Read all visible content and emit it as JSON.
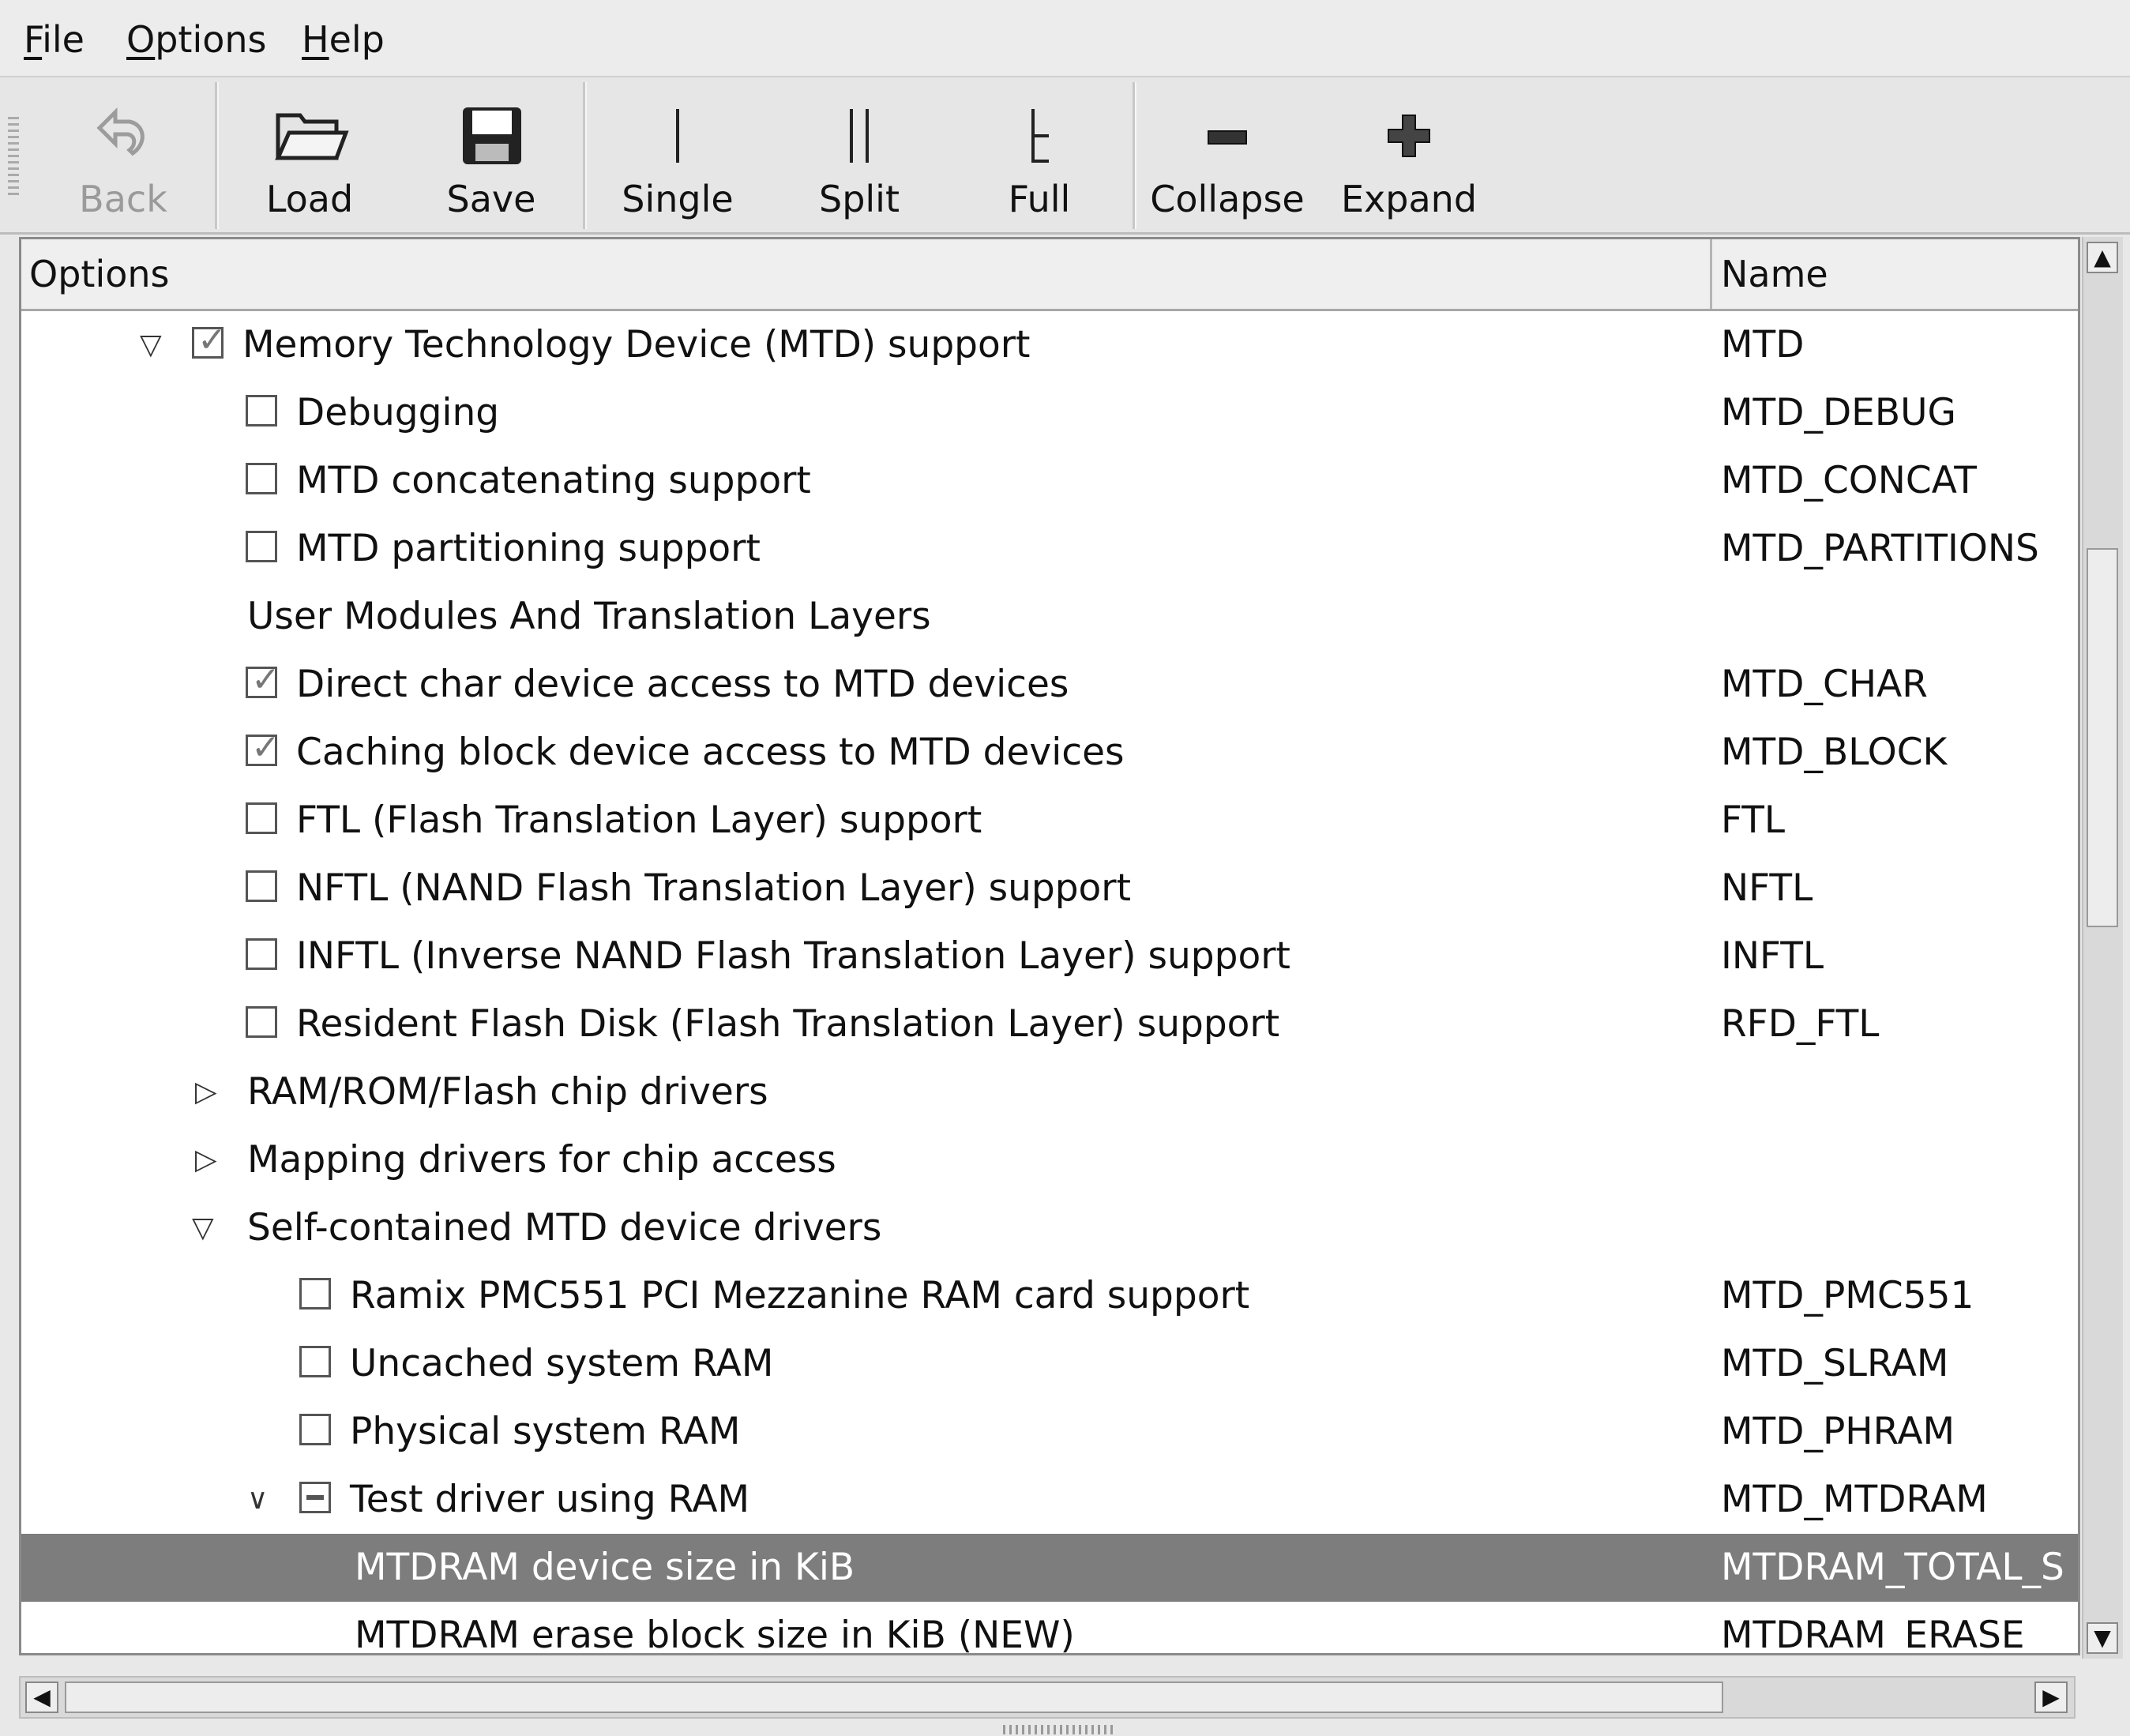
{
  "menu": {
    "file": {
      "mnemonic": "F",
      "rest": "ile"
    },
    "options": {
      "mnemonic": "O",
      "rest": "ptions"
    },
    "help": {
      "mnemonic": "H",
      "rest": "elp"
    }
  },
  "toolbar": {
    "back": "Back",
    "load": "Load",
    "save": "Save",
    "single": "Single",
    "split": "Split",
    "full": "Full",
    "collapse": "Collapse",
    "expand": "Expand"
  },
  "tree": {
    "headers": {
      "options": "Options",
      "name": "Name"
    },
    "rows": [
      {
        "label": "Memory Technology Device (MTD) support",
        "name": "MTD",
        "checkbox": "checked",
        "expander": "expanded"
      },
      {
        "label": "Debugging",
        "name": "MTD_DEBUG",
        "checkbox": "unchecked"
      },
      {
        "label": "MTD concatenating support",
        "name": "MTD_CONCAT",
        "checkbox": "unchecked"
      },
      {
        "label": "MTD partitioning support",
        "name": "MTD_PARTITIONS",
        "checkbox": "unchecked"
      },
      {
        "label": "User Modules And Translation Layers",
        "name": ""
      },
      {
        "label": "Direct char device access to MTD devices",
        "name": "MTD_CHAR",
        "checkbox": "checked"
      },
      {
        "label": "Caching block device access to MTD devices",
        "name": "MTD_BLOCK",
        "checkbox": "checked"
      },
      {
        "label": "FTL (Flash Translation Layer) support",
        "name": "FTL",
        "checkbox": "unchecked"
      },
      {
        "label": "NFTL (NAND Flash Translation Layer) support",
        "name": "NFTL",
        "checkbox": "unchecked"
      },
      {
        "label": "INFTL (Inverse NAND Flash Translation Layer) support",
        "name": "INFTL",
        "checkbox": "unchecked"
      },
      {
        "label": "Resident Flash Disk (Flash Translation Layer) support",
        "name": "RFD_FTL",
        "checkbox": "unchecked"
      },
      {
        "label": "RAM/ROM/Flash chip drivers",
        "name": "",
        "expander": "collapsed"
      },
      {
        "label": "Mapping drivers for chip access",
        "name": "",
        "expander": "collapsed"
      },
      {
        "label": "Self-contained MTD device drivers",
        "name": "",
        "expander": "expanded"
      },
      {
        "label": "Ramix PMC551 PCI Mezzanine RAM card support",
        "name": "MTD_PMC551",
        "checkbox": "unchecked"
      },
      {
        "label": "Uncached system RAM",
        "name": "MTD_SLRAM",
        "checkbox": "unchecked"
      },
      {
        "label": "Physical system RAM",
        "name": "MTD_PHRAM",
        "checkbox": "unchecked"
      },
      {
        "label": "Test driver using RAM",
        "name": "MTD_MTDRAM",
        "checkbox": "partial",
        "expander": "expanded"
      },
      {
        "label": "MTDRAM device size in KiB",
        "name": "MTDRAM_TOTAL_S",
        "selected": true
      },
      {
        "label": "MTDRAM erase block size in KiB (NEW)",
        "name": "MTDRAM_ERASE_"
      }
    ]
  }
}
